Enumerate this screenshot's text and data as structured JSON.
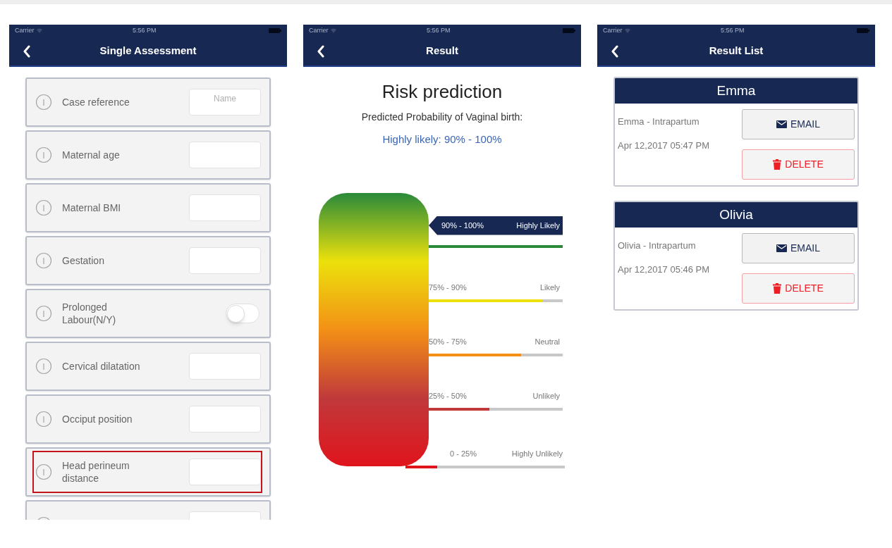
{
  "assessment_screen": {
    "status_bar": {
      "carrier": "Carrier",
      "time": "5:56 PM"
    },
    "title": "Single Assessment",
    "fields": [
      {
        "kind": "text",
        "label": "Case reference",
        "placeholder": "Name",
        "highlighted": false
      },
      {
        "kind": "text",
        "label": "Maternal age",
        "highlighted": false
      },
      {
        "kind": "text",
        "label": "Maternal BMI",
        "highlighted": false
      },
      {
        "kind": "text",
        "label": "Gestation",
        "highlighted": false
      },
      {
        "kind": "toggle",
        "label": "Prolonged Labour(N/Y)",
        "on": false,
        "highlighted": false
      },
      {
        "kind": "text",
        "label": "Cervical dilatation",
        "highlighted": false
      },
      {
        "kind": "text",
        "label": "Occiput position",
        "highlighted": false
      },
      {
        "kind": "text",
        "label": "Head perineum distance",
        "highlighted": true
      },
      {
        "kind": "text",
        "highlighted": false
      }
    ]
  },
  "result_screen": {
    "status_bar": {
      "carrier": "Carrier",
      "time": "5:56 PM"
    },
    "title": "Result",
    "heading": "Risk prediction",
    "subtitle": "Predicted Probability of Vaginal birth:",
    "result": "Highly likely: 90% - 100%",
    "scale": [
      {
        "range": "90% - 100%",
        "label": "Highly Likely",
        "level": 1,
        "color": "#2a8a3a",
        "selected": true
      },
      {
        "range": "75% - 90%",
        "label": "Likely",
        "level": 0.85,
        "color": "#ece10c",
        "selected": false
      },
      {
        "range": "50% - 75%",
        "label": "Neutral",
        "level": 0.69,
        "color": "#f39016",
        "selected": false
      },
      {
        "range": "25% - 50%",
        "label": "Unlikely",
        "level": 0.45,
        "color": "#c0393b",
        "selected": false
      },
      {
        "range": "0 - 25%",
        "label": "Highly Unlikely",
        "level": 0.2,
        "color": "#e0141c",
        "selected": false
      }
    ]
  },
  "result_list_screen": {
    "status_bar": {
      "carrier": "Carrier",
      "time": "5:56 PM"
    },
    "title": "Result List",
    "results": [
      {
        "name": "Emma",
        "description": "Emma - Intrapartum",
        "date": "Apr 12,2017 05:47 PM",
        "email_button": "EMAIL",
        "delete_button": "DELETE"
      },
      {
        "name": "Olivia",
        "description": "Olivia - Intrapartum",
        "date": "Apr 12,2017 05:46 PM",
        "email_button": "EMAIL",
        "delete_button": "DELETE"
      }
    ]
  }
}
